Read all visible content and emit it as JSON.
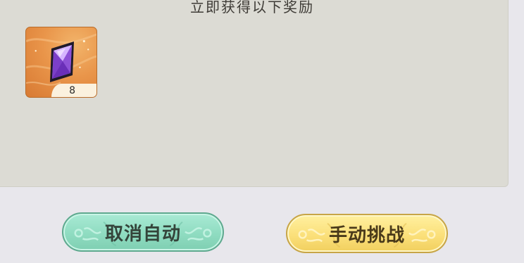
{
  "reward_panel": {
    "title": "立即获得以下奖励",
    "items": [
      {
        "icon": "purple-crystal-icon",
        "count": "8"
      }
    ]
  },
  "buttons": {
    "cancel_auto": "取消自动",
    "manual_challenge": "手动挑战"
  },
  "colors": {
    "panel_bg": "#dcdbd4",
    "page_bg": "#e8e7ec",
    "cancel_button": "#8fdcc1",
    "manual_button": "#fbe07a",
    "item_frame": "#e9954a"
  }
}
